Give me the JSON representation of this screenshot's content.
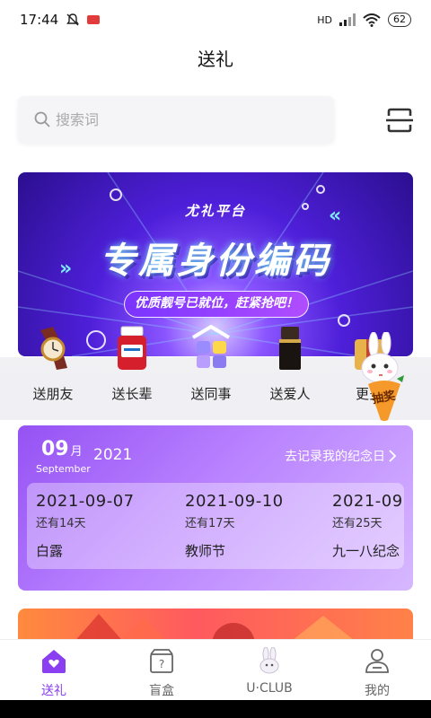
{
  "status_bar": {
    "time": "17:44",
    "network": "HD",
    "battery": "62"
  },
  "header": {
    "title": "送礼"
  },
  "search": {
    "placeholder": "搜索词"
  },
  "banner": {
    "tag": "尤礼平台",
    "headline": "专属身份编码",
    "subline": "优质靓号已就位，赶紧抢吧！"
  },
  "categories": [
    {
      "label": "送朋友",
      "icon": "watch-icon"
    },
    {
      "label": "送长辈",
      "icon": "supplement-bottle-icon"
    },
    {
      "label": "送同事",
      "icon": "gift-blocks-icon"
    },
    {
      "label": "送爱人",
      "icon": "lipstick-icon"
    },
    {
      "label": "更多",
      "icon": "more-gifts-icon"
    }
  ],
  "lucky_draw": {
    "label": "抽奖"
  },
  "calendar": {
    "month": "09",
    "month_unit": "月",
    "month_en": "September",
    "year": "2021",
    "record_link": "去记录我的纪念日",
    "days": [
      {
        "date": "2021-09-07",
        "remaining": "还有14天",
        "name": "白露"
      },
      {
        "date": "2021-09-10",
        "remaining": "还有17天",
        "name": "教师节"
      },
      {
        "date": "2021-09",
        "remaining": "还有25天",
        "name": "九一八纪念"
      }
    ]
  },
  "tabs": [
    {
      "label": "送礼",
      "active": true,
      "icon": "home-heart-icon"
    },
    {
      "label": "盲盒",
      "active": false,
      "icon": "mystery-box-icon"
    },
    {
      "label": "U·CLUB",
      "active": false,
      "icon": "rabbit-icon"
    },
    {
      "label": "我的",
      "active": false,
      "icon": "user-icon"
    }
  ],
  "colors": {
    "accent": "#8a3ff0",
    "banner_bg": "#4e1fd9",
    "card_bg": "#b982ff"
  }
}
